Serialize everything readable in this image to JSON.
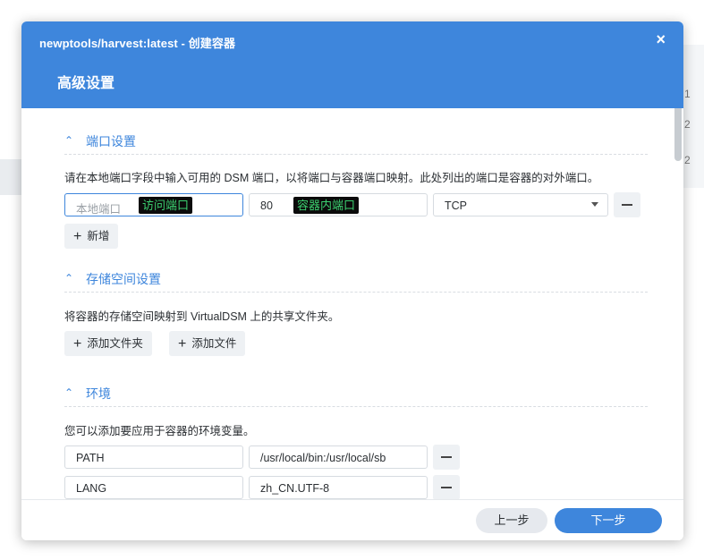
{
  "dialog": {
    "title": "newptools/harvest:latest - 创建容器",
    "close_icon": "×",
    "subtitle": "高级设置"
  },
  "port_section": {
    "title": "端口设置",
    "chevron": "^",
    "description": "请在本地端口字段中输入可用的 DSM 端口，以将端口与容器端口映射。此处列出的端口是容器的对外端口。",
    "rows": [
      {
        "local_placeholder": "本地端口",
        "local_tag": "访问端口",
        "container_value": "80",
        "container_tag": "容器内端口",
        "protocol": "TCP"
      }
    ],
    "add_label": "新增",
    "plus_icon": "+"
  },
  "storage_section": {
    "title": "存储空间设置",
    "chevron": "^",
    "description": "将容器的存储空间映射到 VirtualDSM 上的共享文件夹。",
    "add_folder_label": "添加文件夹",
    "add_file_label": "添加文件",
    "plus_icon": "+"
  },
  "env_section": {
    "title": "环境",
    "chevron": "^",
    "description": "您可以添加要应用于容器的环境变量。",
    "vars": [
      {
        "name": "PATH",
        "value": "/usr/local/bin:/usr/local/sb"
      },
      {
        "name": "LANG",
        "value": "zh_CN.UTF-8"
      }
    ]
  },
  "footer": {
    "prev_label": "上一步",
    "next_label": "下一步"
  },
  "background": {
    "right_chars": [
      "1",
      "2",
      "2"
    ]
  },
  "colors": {
    "accent": "#3e86dc",
    "tag_bg": "#0b0b0b",
    "tag_text": "#3cd070"
  }
}
